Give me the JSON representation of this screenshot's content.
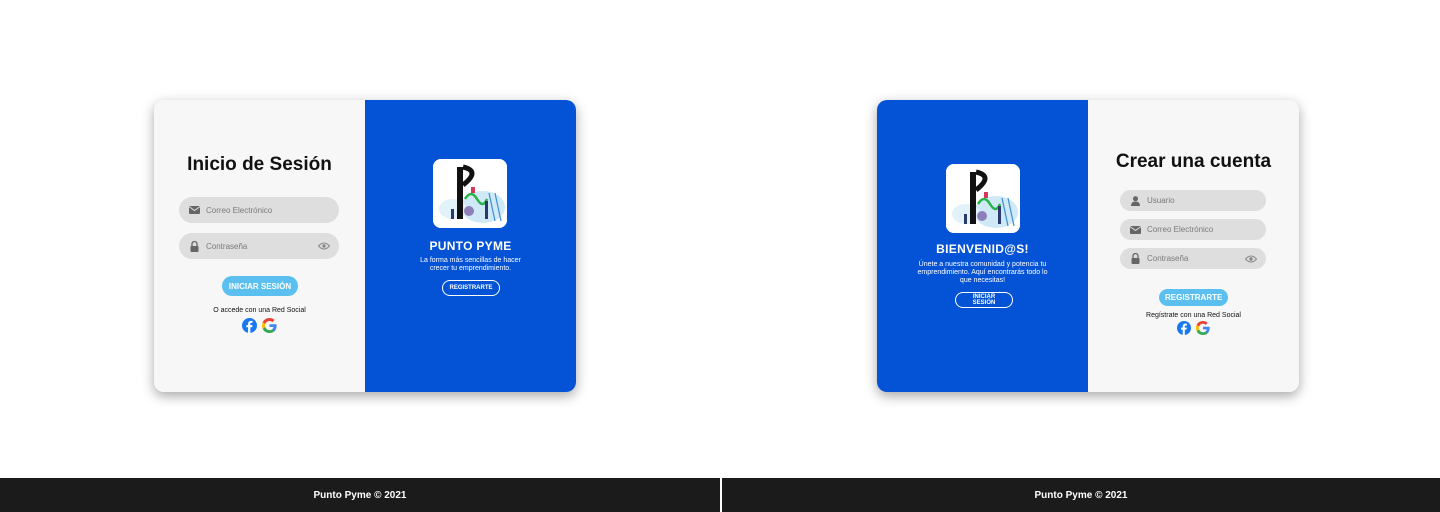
{
  "colors": {
    "brand_blue": "#0453d6",
    "button_blue": "#5bc0f0",
    "footer_bg": "#1b1b1b",
    "field_bg": "#dedede"
  },
  "login": {
    "title": "Inicio de Sesión",
    "email_placeholder": "Correo Electrónico",
    "password_placeholder": "Contraseña",
    "submit_label": "INICIAR SESIÓN",
    "social_text": "O accede con una Red Social",
    "brand": {
      "title": "PUNTO PYME",
      "text": "La forma más sencillas de hacer crecer tu emprendimiento.",
      "button_label": "REGISTRARTE"
    },
    "footer": "Punto Pyme © 2021"
  },
  "register": {
    "title": "Crear una cuenta",
    "user_placeholder": "Usuario",
    "email_placeholder": "Correo Electrónico",
    "password_placeholder": "Contraseña",
    "submit_label": "REGISTRARTE",
    "social_text": "Regístrate con una Red Social",
    "welcome": {
      "title": "BIENVENID@S!",
      "text": "Únete a nuestra comunidad y potencia tu emprendimiento. Aquí encontrarás todo lo que necesitas!",
      "button_label": "INICIAR SESIÓN"
    },
    "footer": "Punto Pyme © 2021"
  },
  "icons": [
    "envelope-icon",
    "lock-icon",
    "eye-icon",
    "user-icon",
    "facebook-icon",
    "google-icon",
    "punto-pyme-logo"
  ]
}
